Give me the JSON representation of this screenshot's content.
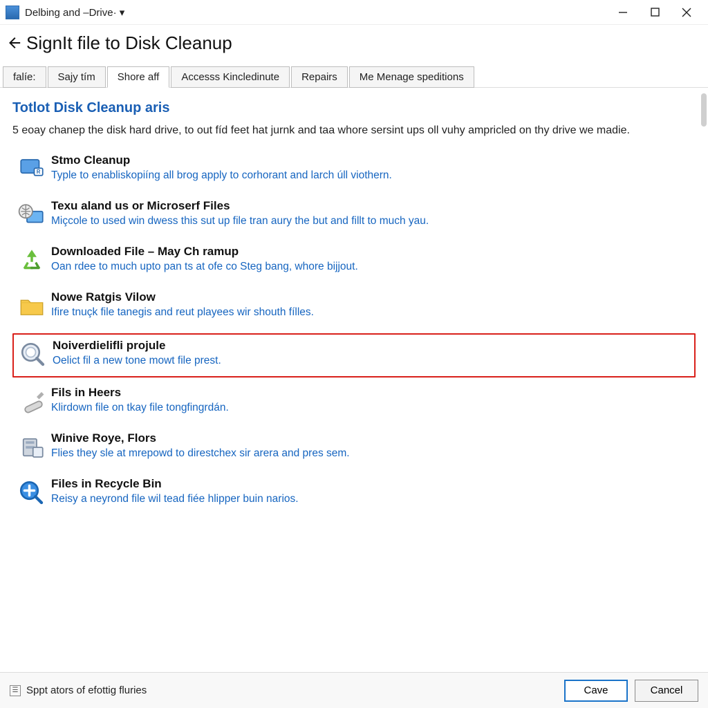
{
  "window": {
    "title": "Delbing and –Drive· ▾"
  },
  "header": {
    "page_title": "SignIt file to Disk Cleanup"
  },
  "tabs": [
    {
      "label": "falíe:",
      "active": false
    },
    {
      "label": "Sajy tím",
      "active": false
    },
    {
      "label": "Shore aff",
      "active": true
    },
    {
      "label": "Accesss Kincledinute",
      "active": false
    },
    {
      "label": "Repairs",
      "active": false
    },
    {
      "label": "Me Menage speditions",
      "active": false
    }
  ],
  "section": {
    "title": "Totlot Disk Cleanup aris",
    "description": "5 eoay chanep the disk hard drive, to out fíd feet hat jurnk and taa whore sersint ups oll vuhy ampricled on thy drive we madie."
  },
  "items": [
    {
      "icon": "computer-monitor-icon",
      "title": "Stmo Cleanup",
      "desc": "Typle to enabliskopiíng all brog apply to corhorant and larch úll viothern.",
      "highlighted": false
    },
    {
      "icon": "globe-screen-icon",
      "title": "Texu aland us or Microserf Files",
      "desc": "Miçcole to used win dwess this sut up file tran aury the but and fillt to much yau.",
      "highlighted": false
    },
    {
      "icon": "recycle-arrows-icon",
      "title": "Downloaded File – May Ch ramup",
      "desc": "Oan rdee to much upto pan ts at ofe co Steg bang, whore bijjout.",
      "highlighted": false
    },
    {
      "icon": "folder-icon",
      "title": "Nowe Ratgis Vilow",
      "desc": "Ifire tnuçk file tanegis and reut playees wir shouth fílles.",
      "highlighted": false
    },
    {
      "icon": "magnifier-icon",
      "title": "Noiverdielifli projule",
      "desc": "Oelict fil a new tone mowt file prest.",
      "highlighted": true
    },
    {
      "icon": "pen-cylinder-icon",
      "title": "Fils in Heers",
      "desc": "Klirdown file on tkay file tongfingrdán.",
      "highlighted": false
    },
    {
      "icon": "disk-stack-icon",
      "title": "Winive Roye, Flors",
      "desc": "Flies they sle at mrepowd to direstchex sir arera and pres sem.",
      "highlighted": false
    },
    {
      "icon": "plus-magnifier-icon",
      "title": "Files in Recycle Bin",
      "desc": "Reisy a neyrond file wil tead fiée hlipper buin narios.",
      "highlighted": false
    }
  ],
  "footer": {
    "hint": "Sppt ators of efottig fluries",
    "primary_label": "Cave",
    "secondary_label": "Cancel"
  },
  "colors": {
    "link": "#1665c0",
    "heading": "#1a5fb4",
    "highlight_border": "#d9201a"
  }
}
